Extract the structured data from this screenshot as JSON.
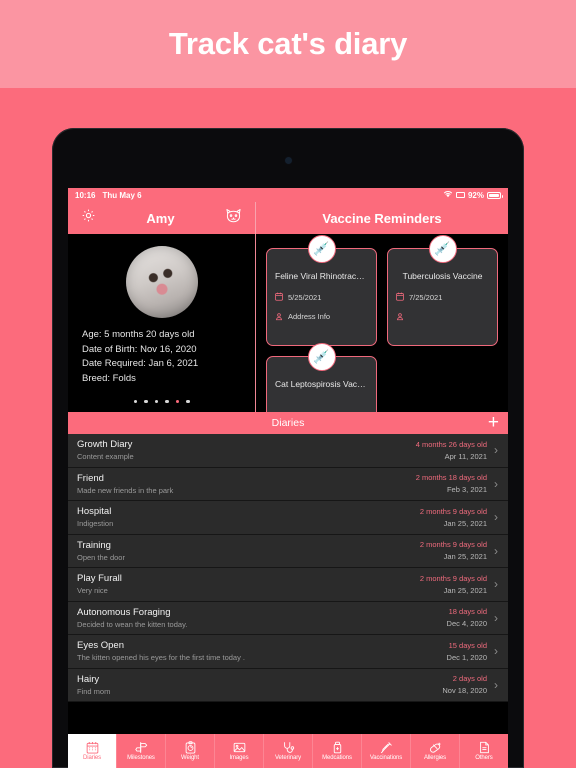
{
  "promo": {
    "title": "Track cat's diary",
    "band_color": "#fb95a2",
    "page_bg": "#fc6b7c"
  },
  "status_bar": {
    "time": "10:16",
    "date": "Thu May 6",
    "wifi_icon": "wifi-icon",
    "location_icon": "location-indicator-icon",
    "battery_percent": "92%",
    "battery_icon": "battery-icon"
  },
  "nav": {
    "settings_icon": "gear-icon",
    "pet_name": "Amy",
    "cat_icon": "cat-face-icon",
    "right_title": "Vaccine Reminders"
  },
  "profile": {
    "photo_alt": "cat-photo",
    "lines": [
      "Age: 5 months 20 days old",
      "Date of Birth: Nov 16, 2020",
      "Date Required: Jan 6, 2021",
      "Breed: Folds"
    ],
    "dots_total": 6,
    "dots_active_index": 4
  },
  "vaccines": {
    "badge_icon": "syringe-icon",
    "date_icon": "calendar-icon",
    "address_icon": "location-pin-icon",
    "cards": [
      {
        "name": "Feline Viral Rhinotracheit...",
        "date": "5/25/2021",
        "address": "Address Info"
      },
      {
        "name": "Tuberculosis Vaccine",
        "date": "7/25/2021",
        "address": ""
      },
      {
        "name": "Cat Leptospirosis Vaccine",
        "date": "",
        "address": ""
      }
    ]
  },
  "diaries": {
    "header_title": "Diaries",
    "add_label": "+",
    "chevron": "›",
    "rows": [
      {
        "title": "Growth Diary",
        "subtitle": "Content example",
        "age": "4 months 26 days old",
        "date": "Apr 11, 2021"
      },
      {
        "title": "Friend",
        "subtitle": "Made new friends in the park",
        "age": "2 months 18 days old",
        "date": "Feb 3, 2021"
      },
      {
        "title": "Hospital",
        "subtitle": "Indigestion",
        "age": "2 months 9 days old",
        "date": "Jan 25, 2021"
      },
      {
        "title": "Training",
        "subtitle": "Open the door",
        "age": "2 months 9 days old",
        "date": "Jan 25, 2021"
      },
      {
        "title": "Play Furall",
        "subtitle": "Very nice",
        "age": "2 months 9 days old",
        "date": "Jan 25, 2021"
      },
      {
        "title": "Autonomous Foraging",
        "subtitle": "Decided to wean the kitten today.",
        "age": "18 days old",
        "date": "Dec 4, 2020"
      },
      {
        "title": "Eyes Open",
        "subtitle": "The kitten opened his eyes for the first time today .",
        "age": "15 days old",
        "date": "Dec 1, 2020"
      },
      {
        "title": "Hairy",
        "subtitle": "Find mom",
        "age": "2 days old",
        "date": "Nov 18, 2020"
      }
    ]
  },
  "tabs": {
    "active_index": 0,
    "items": [
      {
        "label": "Diaries",
        "icon": "calendar-icon"
      },
      {
        "label": "Milestones",
        "icon": "signpost-icon"
      },
      {
        "label": "Weight",
        "icon": "clipboard-scale-icon"
      },
      {
        "label": "Images",
        "icon": "photo-icon"
      },
      {
        "label": "Veterinary",
        "icon": "stethoscope-icon"
      },
      {
        "label": "Medcations",
        "icon": "medicine-bottle-icon"
      },
      {
        "label": "Vaccinations",
        "icon": "syringe-icon"
      },
      {
        "label": "Allergies",
        "icon": "pill-icon"
      },
      {
        "label": "Others",
        "icon": "document-icon"
      }
    ]
  },
  "colors": {
    "accent_pink": "#fc6b7c",
    "card_bg": "#2b2b2b",
    "screen_bg": "#000000"
  }
}
